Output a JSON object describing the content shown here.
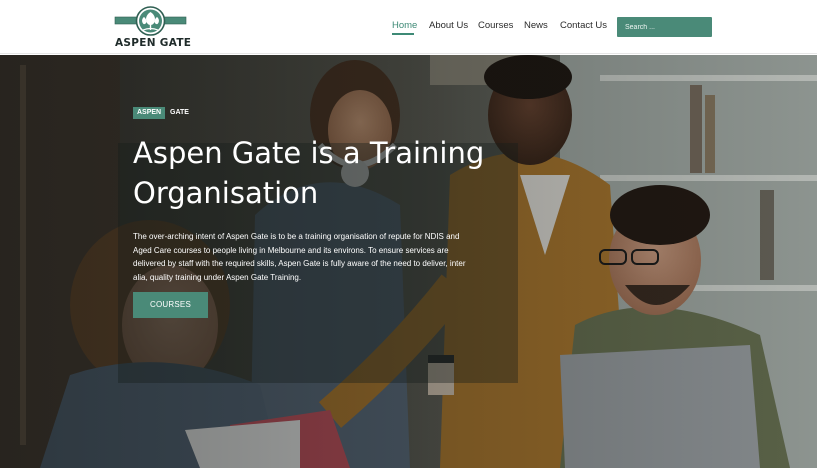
{
  "brand": {
    "name": "ASPEN GATE",
    "logo_icon": "aspen-tree-badge-icon",
    "accent_color": "#4a8a78"
  },
  "nav": {
    "items": [
      {
        "label": "Home",
        "active": true
      },
      {
        "label": "About Us",
        "active": false
      },
      {
        "label": "Courses",
        "active": false
      },
      {
        "label": "News",
        "active": false
      },
      {
        "label": "Contact Us",
        "active": false
      }
    ],
    "search_placeholder": "Search ..."
  },
  "hero": {
    "tag_highlight": "ASPEN",
    "tag_rest": "GATE",
    "title": "Aspen Gate is a Training Organisation",
    "description": "The over-arching intent of Aspen Gate is to be a training organisation of repute for NDIS and Aged Care courses to people living in Melbourne and its environs. To ensure services are delivered by staff with the required skills, Aspen Gate is fully aware of the need to deliver, inter alia, quality training under Aspen Gate Training.",
    "button_label": "COURSES",
    "background_image": "students-collaborating-photo"
  }
}
